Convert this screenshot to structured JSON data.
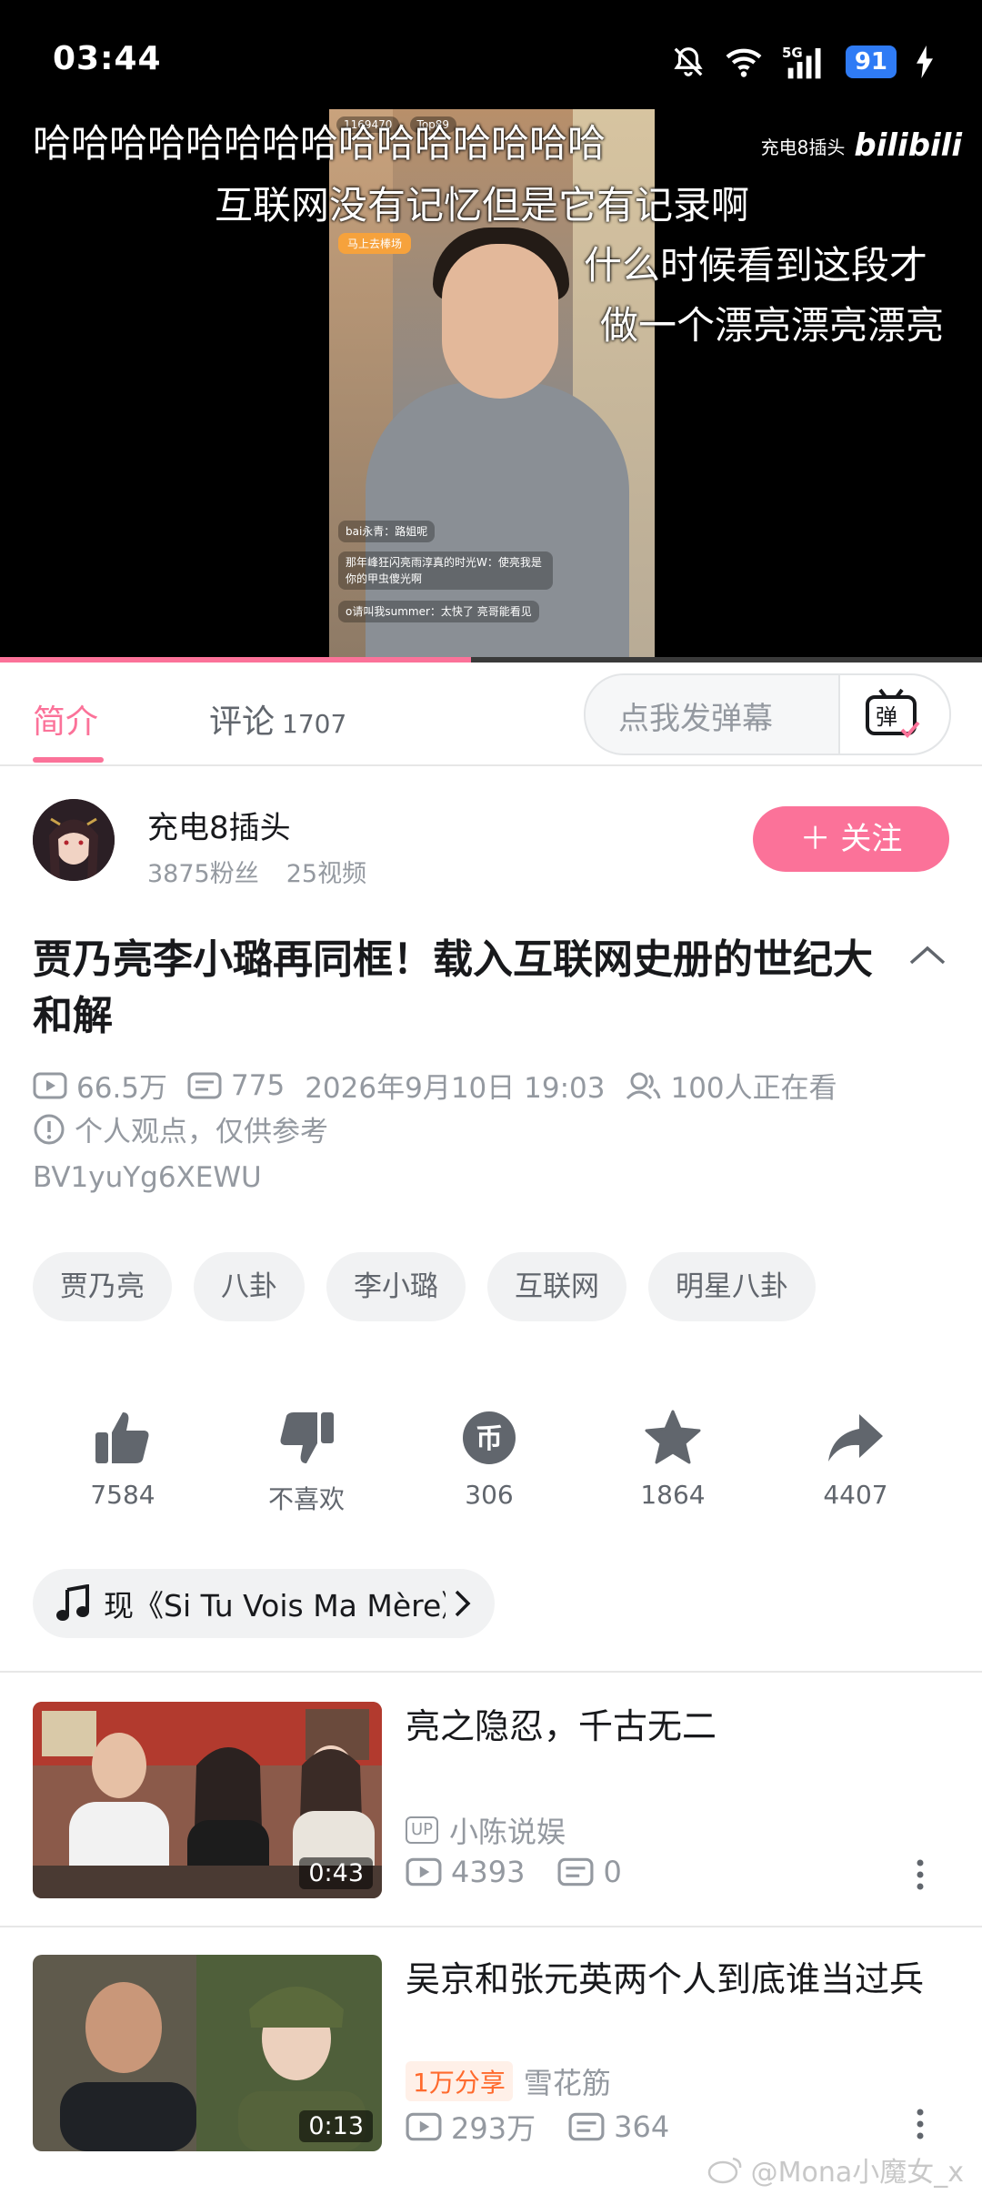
{
  "status_bar": {
    "time": "03:44",
    "network": "5G",
    "battery": "91"
  },
  "video": {
    "danmaku": [
      "哈哈哈哈哈哈哈哈哈哈哈哈哈哈哈",
      "互联网没有记忆但是它有记录啊",
      "什么时候看到这段才",
      "做一个漂亮漂亮漂亮"
    ],
    "watermark_uploader": "充电8插头",
    "watermark_brand": "bilibili",
    "overlay": {
      "viewer_count": "1169470",
      "rank_badge": "Top89",
      "button": "马上去棒场",
      "comments": [
        "bai永青：路姐呢",
        "那年峰狂闪亮雨淳真的时光W：使亮我是你的甲虫傻光啊",
        "o请叫我summer：太快了 亮哥能看见"
      ]
    },
    "progress": 0.48
  },
  "tabs": {
    "intro": "简介",
    "comments": "评论",
    "comments_count": "1707",
    "danmaku_placeholder": "点我发弹幕",
    "danmaku_button": "弹"
  },
  "uploader": {
    "name": "充电8插头",
    "fans": "3875粉丝",
    "videos": "25视频",
    "follow_label": "＋ 关注"
  },
  "video_info": {
    "title": "贾乃亮李小璐再同框！载入互联网史册的世纪大和解",
    "plays": "66.5万",
    "danmaku_count": "775",
    "date": "2026年9月10日 19:03",
    "watching": "100人正在看",
    "notice": "个人观点，仅供参考",
    "bvid": "BV1yuYg6XEWU"
  },
  "tags": [
    "贾乃亮",
    "八卦",
    "李小璐",
    "互联网",
    "明星八卦"
  ],
  "actions": {
    "like": "7584",
    "dislike": "不喜欢",
    "coin": "306",
    "favorite": "1864",
    "share": "4407",
    "coin_glyph": "币"
  },
  "music": {
    "text": "现《Si Tu Vois Ma Mère》"
  },
  "related": [
    {
      "title": "亮之隐忍，千古无二",
      "up_badge": "UP",
      "uploader": "小陈说娱",
      "plays": "4393",
      "danmaku": "0",
      "duration": "0:43"
    },
    {
      "title": "吴京和张元英两个人到底谁当过兵",
      "share_badge": "1万分享",
      "uploader": "雪花筋",
      "plays": "293万",
      "danmaku": "364",
      "duration": "0:13"
    }
  ],
  "footer_watermark": "@Mona小魔女_x",
  "colors": {
    "accent": "#fb7299",
    "battery": "#2f7bf5",
    "share_badge": "#ff6a2d"
  }
}
